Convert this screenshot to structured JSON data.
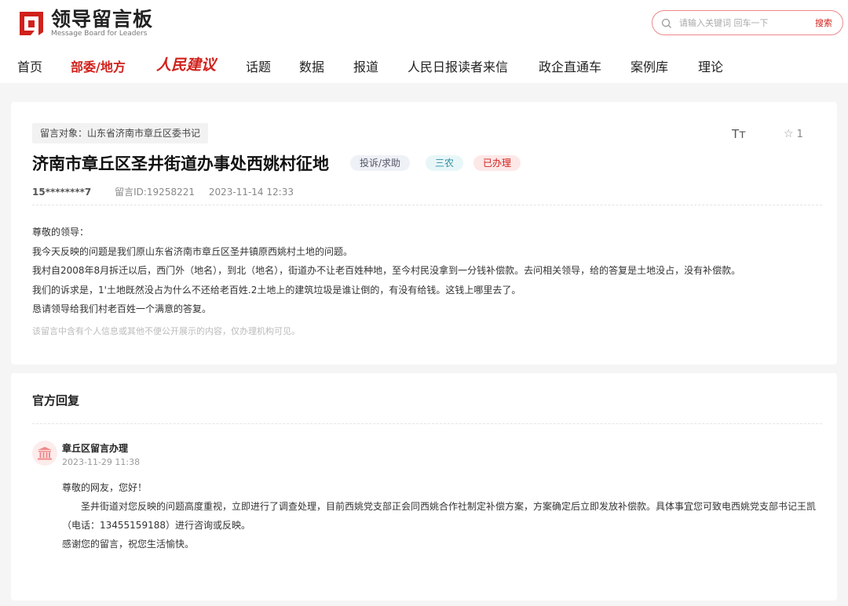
{
  "header": {
    "logo_cn": "领导留言板",
    "logo_en": "Message Board for Leaders",
    "search_placeholder": "请输入关键词 回车一下",
    "search_button": "搜索"
  },
  "nav": {
    "items": [
      "首页",
      "部委/地方",
      "人民建议",
      "话题",
      "数据",
      "报道",
      "人民日报读者来信",
      "政企直通车",
      "案例库",
      "理论"
    ]
  },
  "message": {
    "target": "留言对象：山东省济南市章丘区委书记",
    "font_toggle": "Tт",
    "fav_count": "1",
    "title": "济南市章丘区圣井街道办事处西姚村征地",
    "tags": {
      "category": "投诉/求助",
      "field": "三农",
      "status": "已办理"
    },
    "user": "15********7",
    "message_id": "留言ID:19258221",
    "time": "2023-11-14 12:33",
    "body": [
      "尊敬的领导：",
      "我今天反映的问题是我们原山东省济南市章丘区圣井镇原西姚村土地的问题。",
      "我村自2008年8月拆迁以后，西门外（地名），到北（地名），街道办不让老百姓种地，至今村民没拿到一分钱补偿款。去问相关领导，给的答复是土地没占，没有补偿款。",
      "我们的诉求是，1'土地既然没占为什么不还给老百姓.2土地上的建筑垃圾是谁让倒的，有没有给钱。这钱上哪里去了。",
      "恳请领导给我们村老百姓一个满意的答复。"
    ],
    "privacy_note": "该留言中含有个人信息或其他不便公开展示的内容，仅办理机构可见。"
  },
  "reply": {
    "heading": "官方回复",
    "org": "章丘区留言办理",
    "time": "2023-11-29 11:38",
    "greeting": "尊敬的网友，您好！",
    "body": "圣井街道对您反映的问题高度重视，立即进行了调查处理，目前西姚党支部正会同西姚合作社制定补偿方案，方案确定后立即发放补偿款。具体事宜您可致电西姚党支部书记王凯（电话：13455159188）进行咨询或反映。",
    "closing": "感谢您的留言，祝您生活愉快。"
  },
  "colors": {
    "brand_red": "#d0211c",
    "page_bg": "#f5f5f5"
  },
  "icons": {
    "logo": "logo-mark-icon",
    "search": "search-icon",
    "star": "star-icon",
    "font": "font-size-icon",
    "org": "government-building-icon"
  }
}
